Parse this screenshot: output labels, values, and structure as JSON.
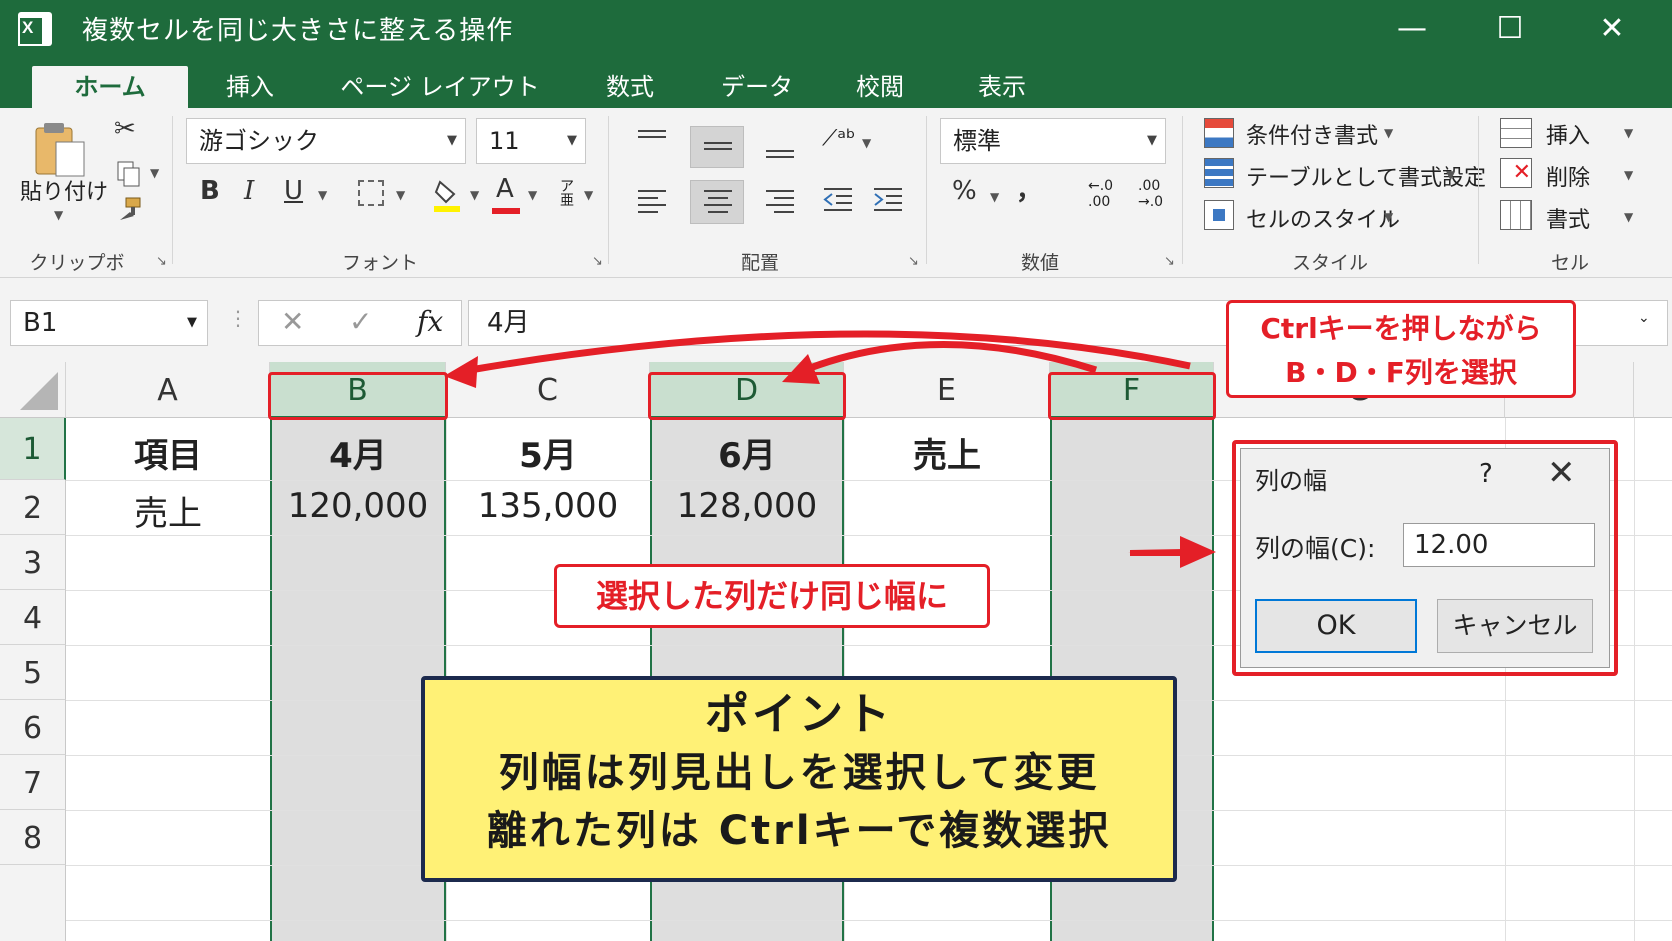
{
  "window": {
    "title": "複数セルを同じ大きさに整える操作",
    "app_icon_letter": "X",
    "minimize": "—",
    "maximize": "☐",
    "close": "✕"
  },
  "tabs": [
    "ホーム",
    "挿入",
    "ページ レイアウト",
    "数式",
    "データ",
    "校閲",
    "表示"
  ],
  "ribbon": {
    "clipboard": {
      "paste": "貼り付け",
      "label": "クリップボード"
    },
    "font": {
      "name": "游ゴシック",
      "size": "11",
      "bold": "B",
      "italic": "I",
      "underline": "U",
      "font_color": "A",
      "label": "フォント"
    },
    "alignment": {
      "label": "配置"
    },
    "number": {
      "format": "標準",
      "percent": "%",
      "comma": "，",
      "inc": "←.0\n.00",
      "dec": ".00\n→.0",
      "label": "数値"
    },
    "styles": {
      "conditional": "条件付き書式",
      "table": "テーブルとして書式設定",
      "cell_styles": "セルのスタイル",
      "label": "スタイル"
    },
    "cells": {
      "insert": "挿入",
      "delete": "削除",
      "format": "書式",
      "label": "セル"
    }
  },
  "formula_bar": {
    "name_box": "B1",
    "cancel": "✕",
    "enter": "✓",
    "fx": "fx",
    "value": "4月"
  },
  "sheet": {
    "columns": [
      "A",
      "B",
      "C",
      "D",
      "E",
      "F",
      "G"
    ],
    "selected_columns": [
      "B",
      "D",
      "F"
    ],
    "rows": [
      "1",
      "2",
      "3",
      "4",
      "5",
      "6",
      "7",
      "8"
    ],
    "row1": {
      "A": "項目",
      "B": "4月",
      "C": "5月",
      "D": "6月",
      "E": "売上"
    },
    "row2": {
      "A": "売上",
      "B": "120,000",
      "C": "135,000",
      "D": "128,000"
    }
  },
  "dialog": {
    "title": "列の幅",
    "help": "?",
    "close": "✕",
    "label": "列の幅(C):",
    "value": "12.00",
    "ok": "OK",
    "cancel": "キャンセル"
  },
  "annotations": {
    "ctrl_callout": [
      "Ctrlキーを押しながら",
      "B・D・F列を選択"
    ],
    "same_width": "選択した列だけ同じ幅に",
    "point_title": "ポイント",
    "point_line1": "列幅は列見出しを選択して変更",
    "point_line2": "離れた列は Ctrlキーで複数選択"
  },
  "colors": {
    "excel_green": "#1e6b3c",
    "annotation_red": "#e41f27",
    "point_yellow": "#fff176",
    "selected_header": "#c9dfcf"
  }
}
